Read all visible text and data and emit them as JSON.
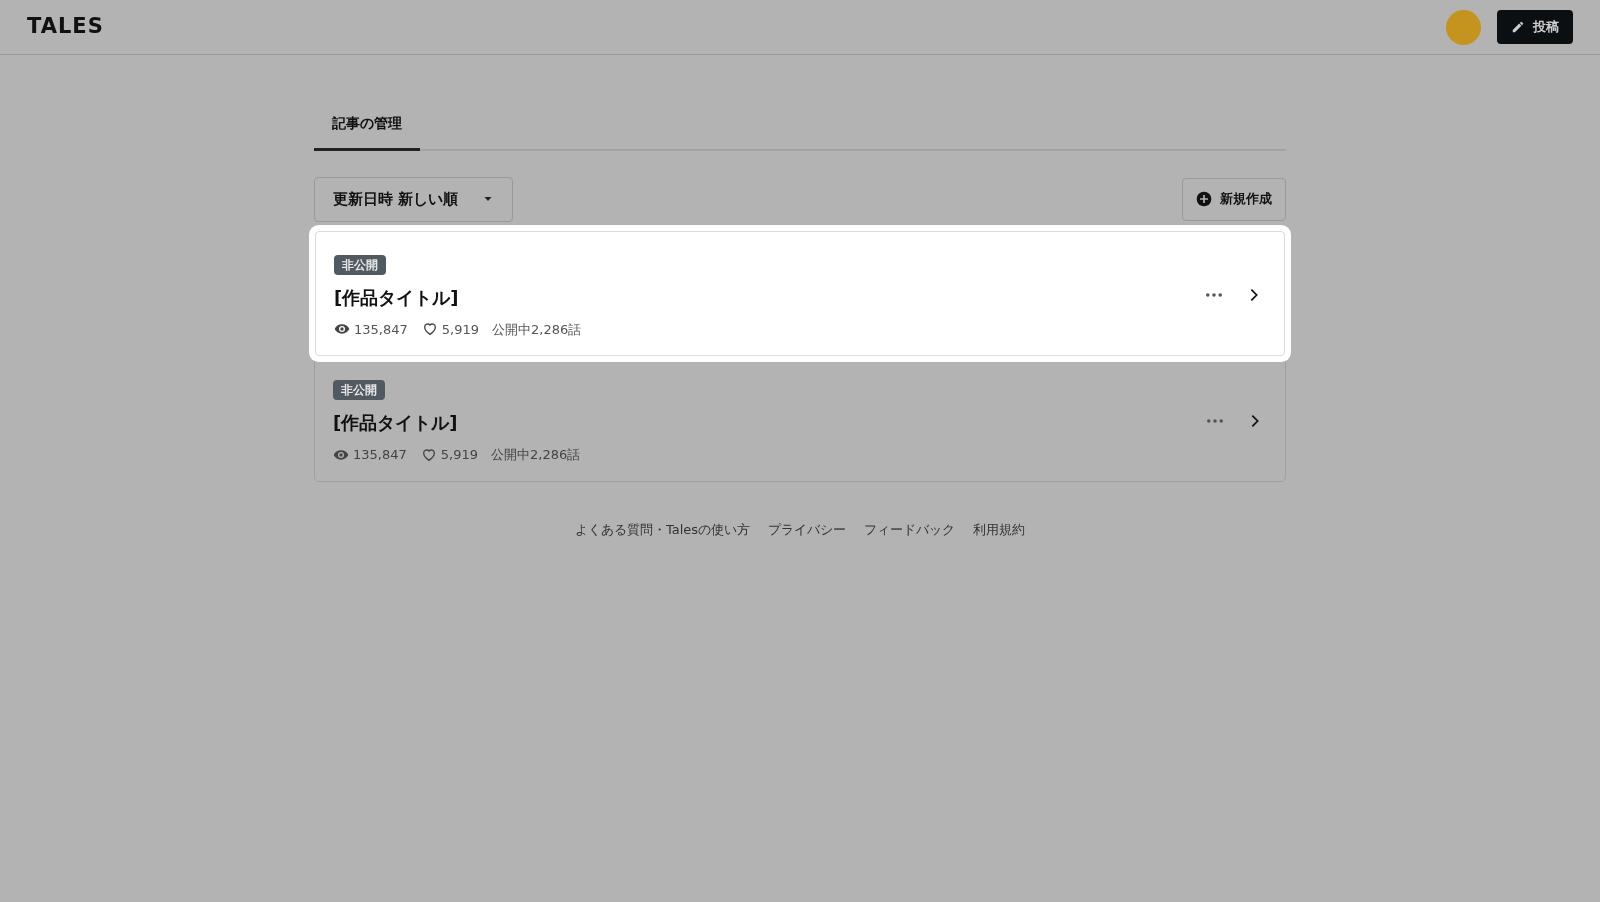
{
  "header": {
    "logo": "TALES",
    "post_button": "投稿"
  },
  "tabs": [
    {
      "label": "記事の管理",
      "selected": true
    }
  ],
  "sort_dropdown": "更新日時 新しい順",
  "new_button": "新規作成",
  "works": [
    {
      "status": "非公開",
      "title": "[作品タイトル]",
      "views": "135,847",
      "likes": "5,919",
      "episodes": "公開中2,286話",
      "highlighted": true
    },
    {
      "status": "非公開",
      "title": "[作品タイトル]",
      "views": "135,847",
      "likes": "5,919",
      "episodes": "公開中2,286話",
      "highlighted": false
    }
  ],
  "footer_links": [
    "よくある質問・Talesの使い方",
    "プライバシー",
    "フィードバック",
    "利用規約"
  ]
}
